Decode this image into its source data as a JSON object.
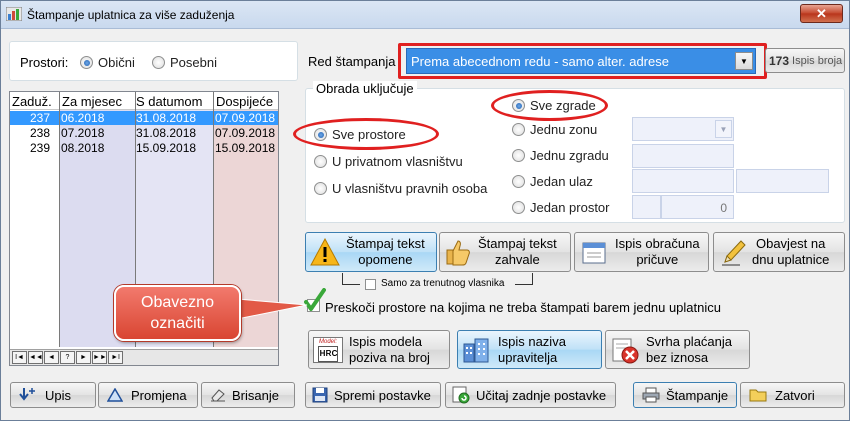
{
  "window": {
    "title": "Štampanje uplatnica za više zaduženja",
    "close_label": "✕"
  },
  "prostori": {
    "label": "Prostori:",
    "options": [
      "Obični",
      "Posebni"
    ],
    "selected": "Obični"
  },
  "red_stampanja": {
    "label": "Red štampanja",
    "value": "Prema abecednom redu - samo alter. adrese",
    "ispis_broja_label": "Ispis broja",
    "ispis_broja_icon_text": "173"
  },
  "list": {
    "columns": [
      "Zaduž.",
      "Za mjesec",
      "S datumom",
      "Dospijeće"
    ],
    "rows": [
      {
        "zaduz": "237",
        "mjesec": "06.2018",
        "datum": "31.08.2018",
        "dospijece": "07.09.2018",
        "selected": true
      },
      {
        "zaduz": "238",
        "mjesec": "07.2018",
        "datum": "31.08.2018",
        "dospijece": "07.09.2018",
        "selected": false
      },
      {
        "zaduz": "239",
        "mjesec": "08.2018",
        "datum": "15.09.2018",
        "dospijece": "15.09.2018",
        "selected": false
      }
    ],
    "nav_buttons": [
      "I◄",
      "◄◄",
      "◄",
      "?",
      "►",
      "►►",
      "►I"
    ]
  },
  "obrada": {
    "label": "Obrada uključuje",
    "left_options": [
      "Sve prostore",
      "U privatnom vlasništvu",
      "U vlasništvu pravnih osoba"
    ],
    "left_selected": "Sve prostore",
    "right_options": [
      "Sve zgrade",
      "Jednu zonu",
      "Jednu zgradu",
      "Jedan ulaz",
      "Jedan prostor"
    ],
    "right_selected": "Sve zgrade",
    "prostor_value": "0"
  },
  "actions": {
    "opomene": "Štampaj tekst opomene",
    "opomene_l1": "Štampaj tekst",
    "opomene_l2": "opomene",
    "zahvale_l1": "Štampaj tekst",
    "zahvale_l2": "zahvale",
    "pricuve_l1": "Ispis obračuna",
    "pricuve_l2": "pričuve",
    "obavijest_l1": "Obavjest na",
    "obavijest_l2": "dnu uplatnice",
    "samo_label": "Samo za trenutnog vlasnika",
    "preskoci_label": "Preskoči prostore na kojima ne treba štampati barem jednu uplatnicu",
    "model_l1": "Ispis modela",
    "model_l2": "poziva na broj",
    "model_icon_top": "Model:",
    "model_icon_letters": "H R C",
    "naziva_l1": "Ispis naziva",
    "naziva_l2": "upravitelja",
    "svrha_l1": "Svrha plaćanja",
    "svrha_l2": "bez iznosa"
  },
  "annotation": {
    "callout_l1": "Obavezno",
    "callout_l2": "označiti"
  },
  "bottom": {
    "upis": "Upis",
    "promjena": "Promjena",
    "brisanje": "Brisanje",
    "spremi": "Spremi postavke",
    "ucitaj": "Učitaj zadnje postavke",
    "stampanje": "Štampanje",
    "zatvori": "Zatvori"
  },
  "colors": {
    "accent_blue": "#3399ff",
    "annotation_red": "#e02020",
    "check_green": "#3aa83a"
  }
}
